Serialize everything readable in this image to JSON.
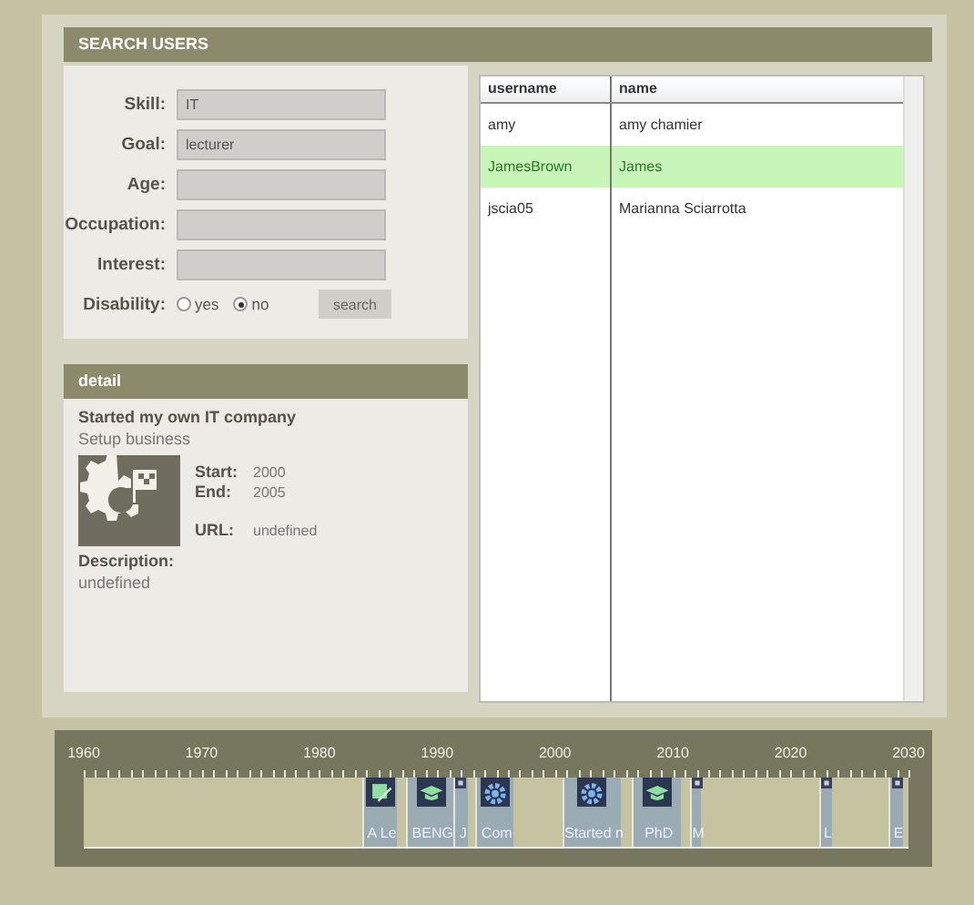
{
  "header": {
    "title": "SEARCH USERS"
  },
  "search_form": {
    "fields": [
      {
        "label": "Skill:",
        "value": "IT"
      },
      {
        "label": "Goal:",
        "value": "lecturer"
      },
      {
        "label": "Age:"
      },
      {
        "label": "Occupation:"
      },
      {
        "label": "Interest:"
      }
    ],
    "disability": {
      "label": "Disability:",
      "options": [
        {
          "label": "yes",
          "selected": false
        },
        {
          "label": "no",
          "selected": true
        }
      ]
    },
    "search_button": "search"
  },
  "detail": {
    "title": "detail",
    "heading": "Started my own IT company",
    "subtitle": "Setup business",
    "start_label": "Start:",
    "start": "2000",
    "end_label": "End:",
    "end": "2005",
    "url_label": "URL:",
    "url": "undefined",
    "description_label": "Description:",
    "description": "undefined"
  },
  "table": {
    "columns": [
      "username",
      "name"
    ],
    "rows": [
      {
        "cells": [
          "amy",
          "amy chamier"
        ],
        "selected": false
      },
      {
        "cells": [
          "JamesBrown",
          "James"
        ],
        "selected": true
      },
      {
        "cells": [
          "jscia05",
          "Marianna Sciarrotta"
        ],
        "selected": false
      }
    ]
  },
  "timeline": {
    "axis_labels": [
      "1960",
      "1970",
      "1980",
      "1990",
      "2000",
      "2010",
      "2020",
      "2030"
    ],
    "items": [
      {
        "label": "A Le",
        "kind": "pencil"
      },
      {
        "label": "BENG",
        "kind": "cap"
      },
      {
        "label": "J",
        "kind": "marker"
      },
      {
        "label": "Com",
        "kind": "gear"
      },
      {
        "label": "Started n",
        "kind": "gear"
      },
      {
        "label": "PhD",
        "kind": "cap"
      },
      {
        "label": "M",
        "kind": "marker"
      },
      {
        "label": "L",
        "kind": "marker"
      },
      {
        "label": "E",
        "kind": "marker"
      }
    ]
  }
}
